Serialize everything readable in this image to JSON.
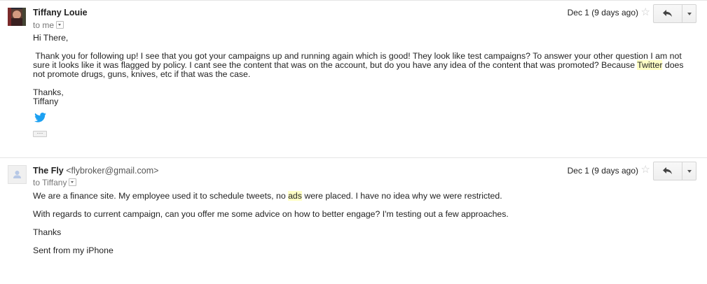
{
  "messages": [
    {
      "sender": "Tiffany Louie",
      "email": "",
      "to": "to me",
      "date": "Dec 1 (9 days ago)",
      "greeting": "Hi There,",
      "body_part1": " Thank you for following up! I see that you got your campaigns up and running again which is good! They look like test campaigns? To answer your other question I am not sure it looks like it was flagged by policy. I cant see the content that was on the account, but do you have any idea of the content that was promoted? Because ",
      "body_highlight": "Twitter",
      "body_part2": " does not promote drugs, guns, knives, etc if that was the case.",
      "signoff": "Thanks,",
      "signature": "Tiffany",
      "logo": "twitter-bird-icon",
      "trimmed_content": "···"
    },
    {
      "sender": "The Fly",
      "email": "<flybroker@gmail.com>",
      "to": "to Tiffany",
      "date": "Dec 1 (9 days ago)",
      "line1_part1": "We are a finance site. My employee used it to schedule tweets, no ",
      "line1_highlight": "ads",
      "line1_part2": " were placed. I have no idea why we were restricted.",
      "line2": "With regards to current campaign, can you offer me some advice on how to better engage? I'm testing out a few approaches.",
      "line3": "Thanks",
      "line4": "Sent from my iPhone"
    }
  ],
  "colors": {
    "highlight": "#ffffc4",
    "twitter": "#1da1f2",
    "star": "#c8c8c8"
  }
}
